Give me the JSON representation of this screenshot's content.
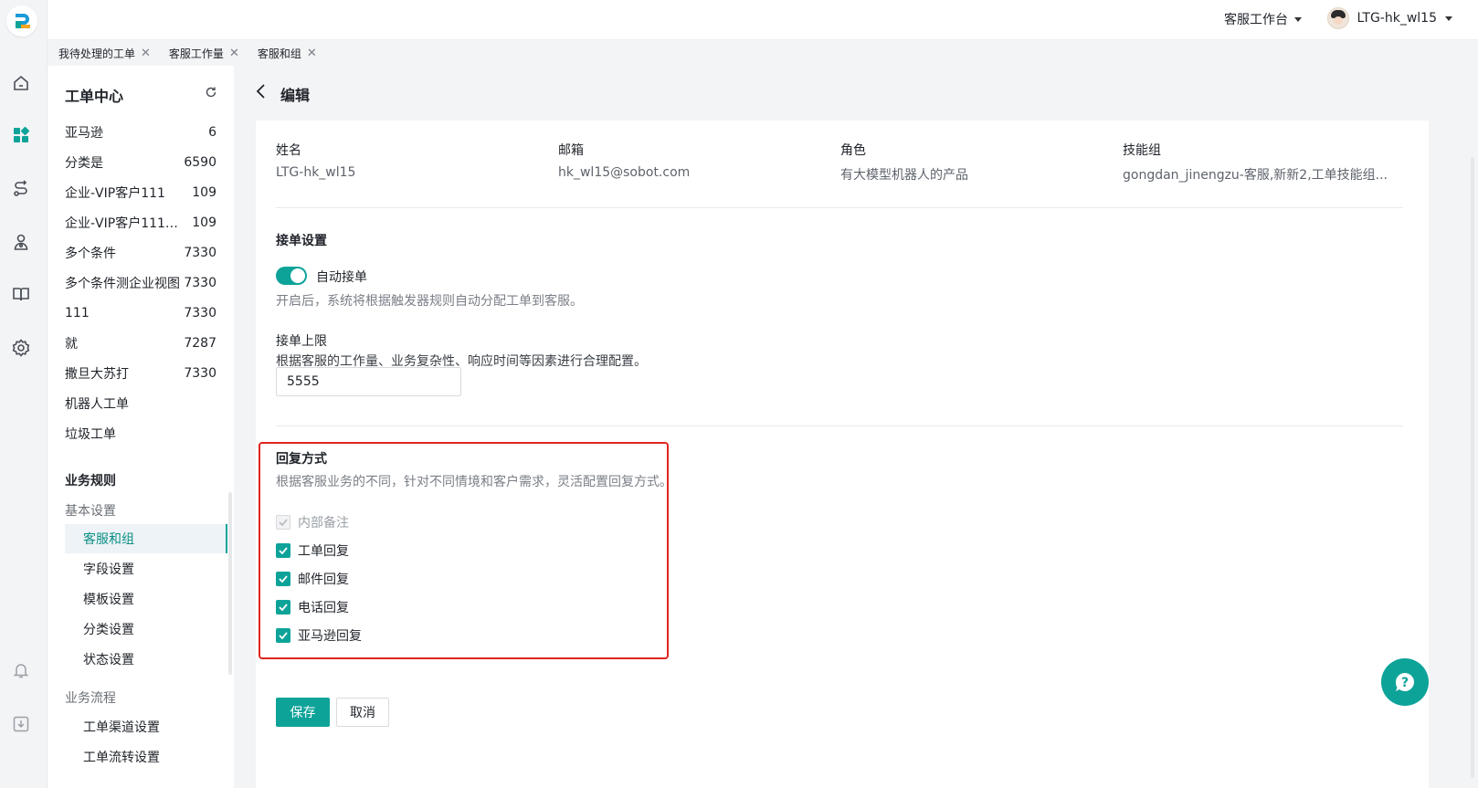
{
  "topbar": {
    "workspace_label": "客服工作台",
    "username": "LTG-hk_wl15"
  },
  "tabs": [
    {
      "label": "我待处理的工单"
    },
    {
      "label": "客服工作量"
    },
    {
      "label": "客服和组"
    }
  ],
  "sidebar": {
    "title": "工单中心",
    "views": [
      {
        "name": "亚马逊",
        "count": "6"
      },
      {
        "name": "分类是",
        "count": "6590"
      },
      {
        "name": "企业-VIP客户111",
        "count": "109"
      },
      {
        "name": "企业-VIP客户111211111",
        "count": "109"
      },
      {
        "name": "多个条件",
        "count": "7330"
      },
      {
        "name": "多个条件测企业视图",
        "count": "7330"
      },
      {
        "name": "111",
        "count": "7330"
      },
      {
        "name": "就",
        "count": "7287"
      },
      {
        "name": "撒旦大苏打",
        "count": "7330"
      },
      {
        "name": "机器人工单",
        "count": ""
      },
      {
        "name": "垃圾工单",
        "count": ""
      }
    ],
    "rules_title": "业务规则",
    "basic_group": "基本设置",
    "basic_items": [
      "客服和组",
      "字段设置",
      "模板设置",
      "分类设置",
      "状态设置"
    ],
    "flow_group": "业务流程",
    "flow_items": [
      "工单渠道设置",
      "工单流转设置"
    ]
  },
  "page": {
    "title": "编辑",
    "info": {
      "name_label": "姓名",
      "name_value": "LTG-hk_wl15",
      "email_label": "邮箱",
      "email_value": "hk_wl15@sobot.com",
      "role_label": "角色",
      "role_value": "有大模型机器人的产品",
      "skill_label": "技能组",
      "skill_value": "gongdan_jinengzu-客服,新新2,工单技能组..."
    },
    "accept": {
      "title": "接单设置",
      "auto_label": "自动接单",
      "auto_enabled": true,
      "auto_desc": "开启后，系统将根据触发器规则自动分配工单到客服。",
      "limit_title": "接单上限",
      "limit_desc": "根据客服的工作量、业务复杂性、响应时间等因素进行合理配置。",
      "limit_value": "5555"
    },
    "reply": {
      "title": "回复方式",
      "desc": "根据客服业务的不同，针对不同情境和客户需求，灵活配置回复方式。",
      "options": [
        {
          "label": "内部备注",
          "checked": true,
          "disabled": true
        },
        {
          "label": "工单回复",
          "checked": true,
          "disabled": false
        },
        {
          "label": "邮件回复",
          "checked": true,
          "disabled": false
        },
        {
          "label": "电话回复",
          "checked": true,
          "disabled": false
        },
        {
          "label": "亚马逊回复",
          "checked": true,
          "disabled": false
        }
      ]
    },
    "buttons": {
      "save": "保存",
      "cancel": "取消"
    }
  },
  "colors": {
    "accent": "#0ea399",
    "highlight_border": "#e0251f"
  },
  "icons": [
    "logo-icon",
    "home-icon",
    "apps-icon",
    "route-icon",
    "user-icon",
    "book-icon",
    "gear-icon",
    "bell-icon",
    "download-icon",
    "refresh-icon",
    "chevron-left-icon",
    "help-icon"
  ]
}
